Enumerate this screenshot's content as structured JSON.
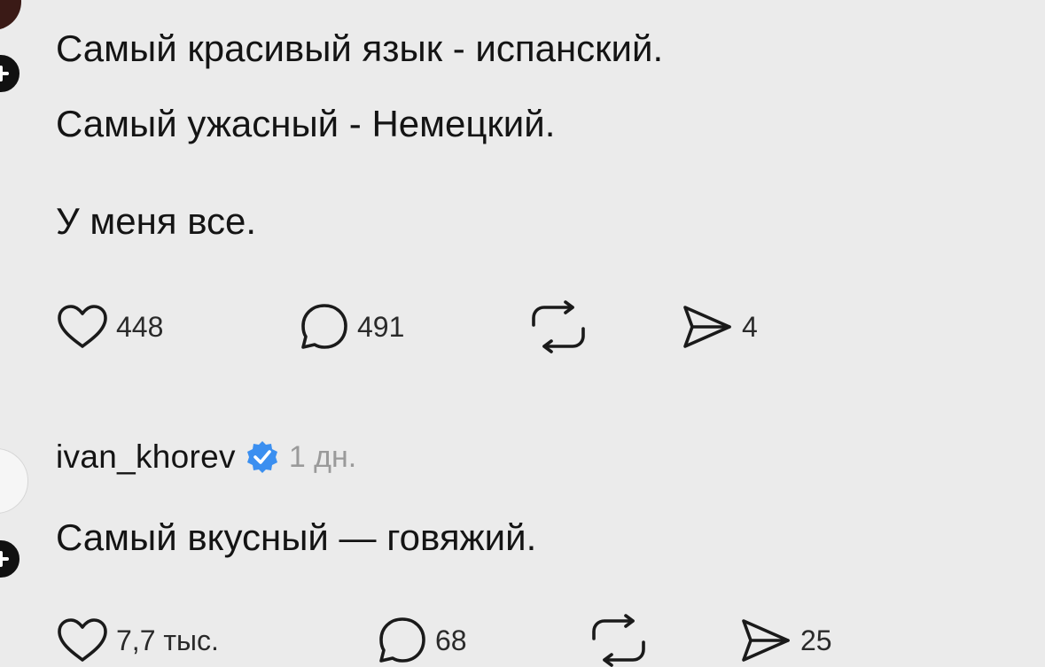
{
  "posts": [
    {
      "lines": [
        "Самый красивый язык - испанский.",
        "Самый ужасный - Немецкий.",
        "У меня все."
      ],
      "likes": "448",
      "replies": "491",
      "shares": "4"
    },
    {
      "username": "ivan_khorev",
      "timestamp": "1 дн.",
      "lines": [
        "Самый вкусный — говяжий."
      ],
      "likes": "7,7 тыс.",
      "replies": "68",
      "shares": "25"
    }
  ],
  "icons": {
    "like": "heart-icon",
    "reply": "speech-bubble-icon",
    "repost": "repost-icon",
    "share": "send-icon",
    "verified": "verified-badge-icon",
    "follow": "plus-icon"
  },
  "colors": {
    "background": "#ebebeb",
    "text": "#141414",
    "muted": "#9a9a9a",
    "verified": "#3b8ff0"
  }
}
